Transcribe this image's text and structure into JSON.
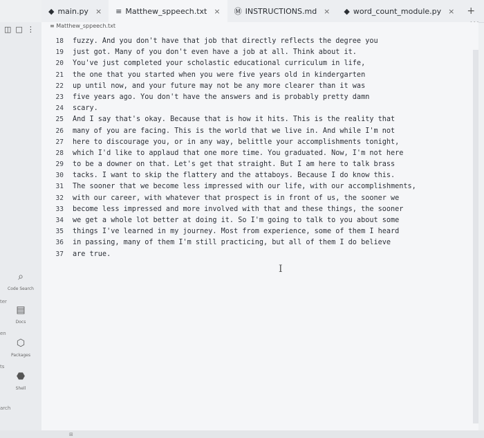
{
  "tabs": [
    {
      "icon": "python-icon",
      "label": "main.py"
    },
    {
      "icon": "text-file-icon",
      "label": "Matthew_sppeech.txt"
    },
    {
      "icon": "markdown-icon",
      "label": "INSTRUCTIONS.md"
    },
    {
      "icon": "python-icon",
      "label": "word_count_module.py"
    }
  ],
  "breadcrumb": "Matthew_sppeech.txt",
  "sidebar": [
    {
      "icon": "search-icon",
      "label": "Code Search"
    },
    {
      "icon": "docs-icon",
      "label": "Docs"
    },
    {
      "icon": "package-icon",
      "label": "Packages"
    },
    {
      "icon": "shell-icon",
      "label": "Shell"
    }
  ],
  "left_cut_labels": [
    "ter",
    "en",
    "ts",
    "arch"
  ],
  "lines": [
    {
      "n": "18",
      "t": "fuzzy. And you don't have that job that directly reflects the degree you"
    },
    {
      "n": "19",
      "t": "just got. Many of you don't even have a job at all. Think about it."
    },
    {
      "n": "20",
      "t": "You've just completed your scholastic educational curriculum in life,"
    },
    {
      "n": "21",
      "t": "the one that you started when you were five years old in kindergarten"
    },
    {
      "n": "22",
      "t": "up until now, and your future may not be any more clearer than it was"
    },
    {
      "n": "23",
      "t": "five years ago. You don't have the answers and is probably pretty damn"
    },
    {
      "n": "24",
      "t": "scary."
    },
    {
      "n": "25",
      "t": "And I say that's okay. Because that is how it hits. This is the reality that"
    },
    {
      "n": "26",
      "t": "many of you are facing. This is the world that we live in. And while I'm not"
    },
    {
      "n": "27",
      "t": "here to discourage you, or in any way, belittle your accomplishments tonight,"
    },
    {
      "n": "28",
      "t": "which I'd like to applaud that one more time. You graduated. Now, I'm not here"
    },
    {
      "n": "29",
      "t": "to be a downer on that. Let's get that straight. But I am here to talk brass"
    },
    {
      "n": "30",
      "t": "tacks. I want to skip the flattery and the attaboys. Because I do know this."
    },
    {
      "n": "31",
      "t": "The sooner that we become less impressed with our life, with our accomplishments,"
    },
    {
      "n": "32",
      "t": "with our career, with whatever that prospect is in front of us, the sooner we"
    },
    {
      "n": "33",
      "t": "become less impressed and more involved with that and these things, the sooner"
    },
    {
      "n": "34",
      "t": "we get a whole lot better at doing it. So I'm going to talk to you about some"
    },
    {
      "n": "35",
      "t": "things I've learned in my journey. Most from experience, some of them I heard"
    },
    {
      "n": "36",
      "t": "in passing, many of them I'm still practicing, but all of them I do believe"
    },
    {
      "n": "37",
      "t": "are true."
    }
  ],
  "more_label": "...",
  "status_label": "⊞"
}
